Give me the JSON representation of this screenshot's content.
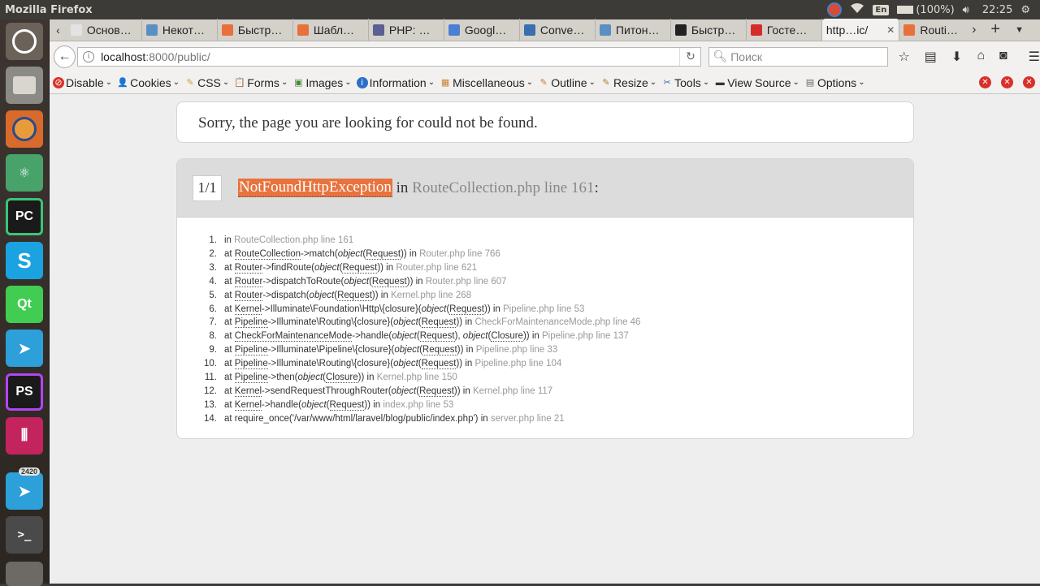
{
  "panel": {
    "app_title": "Mozilla Firefox",
    "battery": "(100%)",
    "time": "22:25",
    "keyboard": "En"
  },
  "launcher": {
    "telegram_count": "2420"
  },
  "tabs": [
    {
      "label": "Основ…",
      "color": "#e3e3e3"
    },
    {
      "label": "Некот…",
      "color": "#5a8fc4"
    },
    {
      "label": "Быстр…",
      "color": "#e8703a"
    },
    {
      "label": "Шабл…",
      "color": "#e8703a"
    },
    {
      "label": "PHP: …",
      "color": "#5b5f94"
    },
    {
      "label": "Googl…",
      "color": "#4a80d4"
    },
    {
      "label": "Conve…",
      "color": "#3a6fb0"
    },
    {
      "label": "Питон…",
      "color": "#5a8fc4"
    },
    {
      "label": "Быстр…",
      "color": "#222222"
    },
    {
      "label": "Госте…",
      "color": "#d62b2b"
    }
  ],
  "active_tab": {
    "label": "http…ic/"
  },
  "tab_after": {
    "label": "Routi…"
  },
  "url": {
    "host": "localhost",
    "path": ":8000/public/"
  },
  "search": {
    "placeholder": "Поиск"
  },
  "devbar": [
    {
      "label": "Disable",
      "icon": "stop",
      "color": "#d9302a"
    },
    {
      "label": "Cookies",
      "icon": "person",
      "color": "#333"
    },
    {
      "label": "CSS",
      "icon": "pencil",
      "color": "#c9a227"
    },
    {
      "label": "Forms",
      "icon": "clipboard",
      "color": "#b07a2e"
    },
    {
      "label": "Images",
      "icon": "image",
      "color": "#4a8a3a"
    },
    {
      "label": "Information",
      "icon": "info",
      "color": "#2d6fc7"
    },
    {
      "label": "Miscellaneous",
      "icon": "box",
      "color": "#c9822e"
    },
    {
      "label": "Outline",
      "icon": "pencil",
      "color": "#c97a2e"
    },
    {
      "label": "Resize",
      "icon": "ruler",
      "color": "#b07a2e"
    },
    {
      "label": "Tools",
      "icon": "tools",
      "color": "#3a6fb0"
    },
    {
      "label": "View Source",
      "icon": "source",
      "color": "#333"
    },
    {
      "label": "Options",
      "icon": "options",
      "color": "#666"
    }
  ],
  "page": {
    "sorry": "Sorry, the page you are looking for could not be found.",
    "exception": {
      "count": "1/1",
      "class": "NotFoundHttpException",
      "in": " in ",
      "location": "RouteCollection.php line 161",
      "colon": ":"
    },
    "trace": [
      {
        "n": "1.",
        "parts": [
          [
            "t",
            "in "
          ]
        ],
        "file": "RouteCollection.php line 161"
      },
      {
        "n": "2.",
        "parts": [
          [
            "t",
            "at "
          ],
          [
            "a",
            "RouteCollection"
          ],
          [
            "t",
            "->match("
          ],
          [
            "i",
            "object"
          ],
          [
            "t",
            "("
          ],
          [
            "a",
            "Request"
          ],
          [
            "t",
            "))"
          ],
          [
            "t",
            " in "
          ]
        ],
        "file": "Router.php line 766"
      },
      {
        "n": "3.",
        "parts": [
          [
            "t",
            "at "
          ],
          [
            "a",
            "Router"
          ],
          [
            "t",
            "->findRoute("
          ],
          [
            "i",
            "object"
          ],
          [
            "t",
            "("
          ],
          [
            "a",
            "Request"
          ],
          [
            "t",
            "))"
          ],
          [
            "t",
            " in "
          ]
        ],
        "file": "Router.php line 621"
      },
      {
        "n": "4.",
        "parts": [
          [
            "t",
            "at "
          ],
          [
            "a",
            "Router"
          ],
          [
            "t",
            "->dispatchToRoute("
          ],
          [
            "i",
            "object"
          ],
          [
            "t",
            "("
          ],
          [
            "a",
            "Request"
          ],
          [
            "t",
            "))"
          ],
          [
            "t",
            " in "
          ]
        ],
        "file": "Router.php line 607"
      },
      {
        "n": "5.",
        "parts": [
          [
            "t",
            "at "
          ],
          [
            "a",
            "Router"
          ],
          [
            "t",
            "->dispatch("
          ],
          [
            "i",
            "object"
          ],
          [
            "t",
            "("
          ],
          [
            "a",
            "Request"
          ],
          [
            "t",
            "))"
          ],
          [
            "t",
            " in "
          ]
        ],
        "file": "Kernel.php line 268"
      },
      {
        "n": "6.",
        "parts": [
          [
            "t",
            "at "
          ],
          [
            "a",
            "Kernel"
          ],
          [
            "t",
            "->Illuminate\\Foundation\\Http\\{closure}("
          ],
          [
            "i",
            "object"
          ],
          [
            "t",
            "("
          ],
          [
            "a",
            "Request"
          ],
          [
            "t",
            "))"
          ],
          [
            "t",
            " in "
          ]
        ],
        "file": "Pipeline.php line 53"
      },
      {
        "n": "7.",
        "parts": [
          [
            "t",
            "at "
          ],
          [
            "a",
            "Pipeline"
          ],
          [
            "t",
            "->Illuminate\\Routing\\{closure}("
          ],
          [
            "i",
            "object"
          ],
          [
            "t",
            "("
          ],
          [
            "a",
            "Request"
          ],
          [
            "t",
            "))"
          ],
          [
            "t",
            " in "
          ]
        ],
        "file": "CheckForMaintenanceMode.php line 46"
      },
      {
        "n": "8.",
        "parts": [
          [
            "t",
            "at "
          ],
          [
            "a",
            "CheckForMaintenanceMode"
          ],
          [
            "t",
            "->handle("
          ],
          [
            "i",
            "object"
          ],
          [
            "t",
            "("
          ],
          [
            "a",
            "Request"
          ],
          [
            "t",
            "), "
          ],
          [
            "i",
            "object"
          ],
          [
            "t",
            "("
          ],
          [
            "a",
            "Closure"
          ],
          [
            "t",
            "))"
          ],
          [
            "t",
            " in "
          ]
        ],
        "file": "Pipeline.php line 137"
      },
      {
        "n": "9.",
        "parts": [
          [
            "t",
            "at "
          ],
          [
            "a",
            "Pipeline"
          ],
          [
            "t",
            "->Illuminate\\Pipeline\\{closure}("
          ],
          [
            "i",
            "object"
          ],
          [
            "t",
            "("
          ],
          [
            "a",
            "Request"
          ],
          [
            "t",
            "))"
          ],
          [
            "t",
            " in "
          ]
        ],
        "file": "Pipeline.php line 33"
      },
      {
        "n": "10.",
        "parts": [
          [
            "t",
            "at "
          ],
          [
            "a",
            "Pipeline"
          ],
          [
            "t",
            "->Illuminate\\Routing\\{closure}("
          ],
          [
            "i",
            "object"
          ],
          [
            "t",
            "("
          ],
          [
            "a",
            "Request"
          ],
          [
            "t",
            "))"
          ],
          [
            "t",
            " in "
          ]
        ],
        "file": "Pipeline.php line 104"
      },
      {
        "n": "11.",
        "parts": [
          [
            "t",
            "at "
          ],
          [
            "a",
            "Pipeline"
          ],
          [
            "t",
            "->then("
          ],
          [
            "i",
            "object"
          ],
          [
            "t",
            "("
          ],
          [
            "a",
            "Closure"
          ],
          [
            "t",
            "))"
          ],
          [
            "t",
            " in "
          ]
        ],
        "file": "Kernel.php line 150"
      },
      {
        "n": "12.",
        "parts": [
          [
            "t",
            "at "
          ],
          [
            "a",
            "Kernel"
          ],
          [
            "t",
            "->sendRequestThroughRouter("
          ],
          [
            "i",
            "object"
          ],
          [
            "t",
            "("
          ],
          [
            "a",
            "Request"
          ],
          [
            "t",
            "))"
          ],
          [
            "t",
            " in "
          ]
        ],
        "file": "Kernel.php line 117"
      },
      {
        "n": "13.",
        "parts": [
          [
            "t",
            "at "
          ],
          [
            "a",
            "Kernel"
          ],
          [
            "t",
            "->handle("
          ],
          [
            "i",
            "object"
          ],
          [
            "t",
            "("
          ],
          [
            "a",
            "Request"
          ],
          [
            "t",
            "))"
          ],
          [
            "t",
            " in "
          ]
        ],
        "file": "index.php line 53"
      },
      {
        "n": "14.",
        "parts": [
          [
            "t",
            "at require_once('/var/www/html/laravel/blog/public/index.php')"
          ],
          [
            "t",
            " in "
          ]
        ],
        "file": "server.php line 21"
      }
    ]
  }
}
